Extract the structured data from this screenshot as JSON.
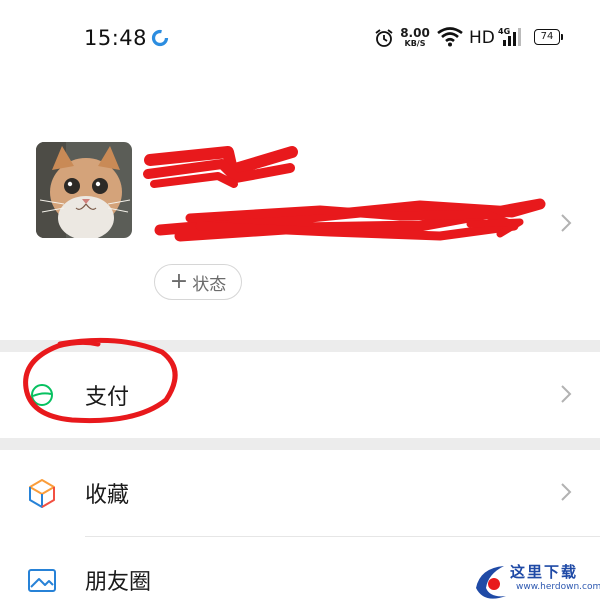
{
  "status_bar": {
    "time": "15:48",
    "net_speed_value": "8.00",
    "net_speed_unit": "KB/S",
    "network_type": "HD",
    "signal_label": "4G",
    "battery_level": "74"
  },
  "profile": {
    "status_button_plus": "+",
    "status_button_label": "状态"
  },
  "menu": {
    "pay_label": "支付",
    "favorites_label": "收藏",
    "moments_label": "朋友圈"
  },
  "watermark": {
    "text": "这里下载",
    "url": "www.herdown.com"
  },
  "colors": {
    "accent_green": "#07c160",
    "annotation_red": "#e8191c",
    "divider_gray": "#ececec"
  }
}
